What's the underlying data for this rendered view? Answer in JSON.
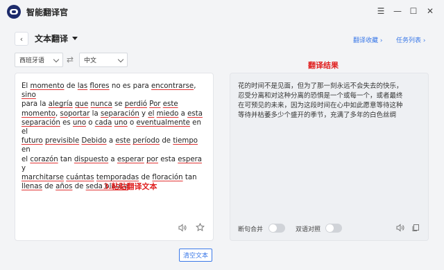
{
  "app": {
    "title": "智能翻译官"
  },
  "window_controls": {
    "menu": "☰",
    "minimize": "—",
    "maximize": "☐",
    "close": "✕"
  },
  "header": {
    "back": "‹",
    "title": "文本翻译",
    "links": [
      {
        "label": "翻译收藏 ›"
      },
      {
        "label": "任务列表 ›"
      }
    ]
  },
  "languages": {
    "source": "西班牙语",
    "target": "中文",
    "swap_icon": "⇄"
  },
  "source_panel": {
    "lines": [
      [
        {
          "t": "El ",
          "u": false
        },
        {
          "t": "momento",
          "u": true
        },
        {
          "t": " de ",
          "u": false
        },
        {
          "t": "las",
          "u": true
        },
        {
          "t": " ",
          "u": false
        },
        {
          "t": "flores",
          "u": true
        },
        {
          "t": " no es para ",
          "u": false
        },
        {
          "t": "encontrarse",
          "u": true
        },
        {
          "t": ", ",
          "u": false
        },
        {
          "t": "sino",
          "u": true
        }
      ],
      [
        {
          "t": "para la ",
          "u": false
        },
        {
          "t": "alegría",
          "u": true
        },
        {
          "t": " ",
          "u": false
        },
        {
          "t": "que",
          "u": true
        },
        {
          "t": " ",
          "u": false
        },
        {
          "t": "nunca",
          "u": true
        },
        {
          "t": " se ",
          "u": false
        },
        {
          "t": "perdió",
          "u": true
        },
        {
          "t": " ",
          "u": false
        },
        {
          "t": "Por",
          "u": true
        },
        {
          "t": " ",
          "u": false
        },
        {
          "t": "este",
          "u": true
        }
      ],
      [
        {
          "t": "momento",
          "u": true
        },
        {
          "t": ", ",
          "u": false
        },
        {
          "t": "soportar",
          "u": true
        },
        {
          "t": " la ",
          "u": false
        },
        {
          "t": "separación",
          "u": true
        },
        {
          "t": " y ",
          "u": false
        },
        {
          "t": "el",
          "u": true
        },
        {
          "t": " ",
          "u": false
        },
        {
          "t": "miedo",
          "u": true
        },
        {
          "t": " a ",
          "u": false
        },
        {
          "t": "esta",
          "u": true
        }
      ],
      [
        {
          "t": "separación",
          "u": true
        },
        {
          "t": " es ",
          "u": false
        },
        {
          "t": "uno",
          "u": true
        },
        {
          "t": " o ",
          "u": false
        },
        {
          "t": "cada",
          "u": true
        },
        {
          "t": " ",
          "u": false
        },
        {
          "t": "uno",
          "u": true
        },
        {
          "t": " o ",
          "u": false
        },
        {
          "t": "eventualmente",
          "u": true
        },
        {
          "t": " en el",
          "u": false
        }
      ],
      [
        {
          "t": "futuro",
          "u": true
        },
        {
          "t": " ",
          "u": false
        },
        {
          "t": "previsible",
          "u": true
        },
        {
          "t": " ",
          "u": false
        },
        {
          "t": "Debido",
          "u": true
        },
        {
          "t": " a ",
          "u": false
        },
        {
          "t": "este",
          "u": true
        },
        {
          "t": " ",
          "u": false
        },
        {
          "t": "período",
          "u": true
        },
        {
          "t": " de ",
          "u": false
        },
        {
          "t": "tiempo",
          "u": true
        },
        {
          "t": " en",
          "u": false
        }
      ],
      [
        {
          "t": "el ",
          "u": false
        },
        {
          "t": "corazón",
          "u": true
        },
        {
          "t": " tan ",
          "u": false
        },
        {
          "t": "dispuesto",
          "u": true
        },
        {
          "t": " a ",
          "u": false
        },
        {
          "t": "esperar",
          "u": true
        },
        {
          "t": " ",
          "u": false
        },
        {
          "t": "por",
          "u": true
        },
        {
          "t": " esta ",
          "u": false
        },
        {
          "t": "espera",
          "u": true
        },
        {
          "t": " y",
          "u": false
        }
      ],
      [
        {
          "t": "marchitarse",
          "u": true
        },
        {
          "t": " ",
          "u": false
        },
        {
          "t": "cuántas",
          "u": true
        },
        {
          "t": " ",
          "u": false
        },
        {
          "t": "temporadas",
          "u": true
        },
        {
          "t": " de ",
          "u": false
        },
        {
          "t": "floración",
          "u": true
        },
        {
          "t": " tan",
          "u": false
        }
      ],
      [
        {
          "t": "llenas",
          "u": true
        },
        {
          "t": " de ",
          "u": false
        },
        {
          "t": "años",
          "u": true
        },
        {
          "t": " de ",
          "u": false
        },
        {
          "t": "seda blanca",
          "u": true
        }
      ]
    ],
    "annotation": "3.粘贴翻译文本",
    "speaker_icon": "speaker-icon",
    "star_icon": "star-icon"
  },
  "target_panel": {
    "label": "翻译结果",
    "lines": [
      "花的时间不是见面，但为了那一刻永远不会失去的快乐，",
      "忍受分离和对这种分离的恐惧是一个或每一个，或者最终",
      "在可预见的未来，因为这段时间在心中如此愿意等待这种",
      "等待并枯萎多少个盛开的季节，充满了多年的白色丝绸"
    ],
    "toggle_sentence": "断句合并",
    "toggle_bilingual": "双语对照",
    "speaker_icon": "speaker-icon",
    "copy_icon": "copy-icon"
  },
  "footer": {
    "clear_button": "清空文本"
  },
  "colors": {
    "accent": "#3a78e8",
    "annotation": "#e02020",
    "underline": "#e03030"
  }
}
